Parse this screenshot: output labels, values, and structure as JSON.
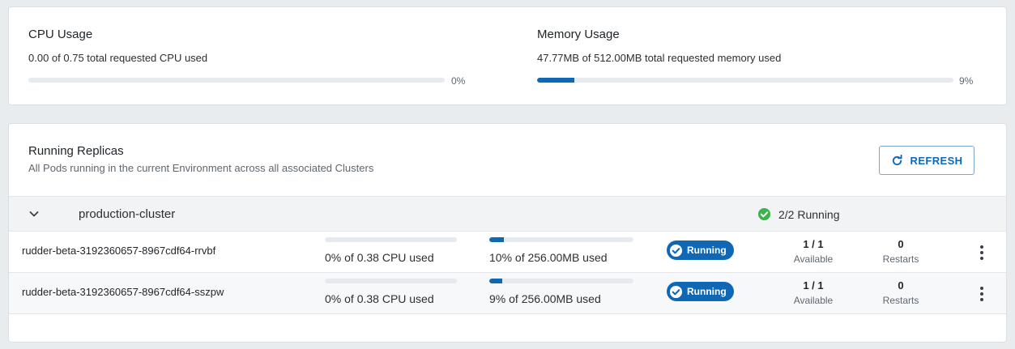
{
  "cpu": {
    "title": "CPU Usage",
    "subtitle": "0.00 of 0.75 total requested CPU used",
    "percent_label": "0%",
    "fill": 0
  },
  "memory": {
    "title": "Memory Usage",
    "subtitle": "47.77MB of 512.00MB total requested memory used",
    "percent_label": "9%",
    "fill": 9
  },
  "replicas": {
    "title": "Running Replicas",
    "subtitle": "All Pods running in the current Environment across all associated Clusters",
    "refresh_label": "REFRESH"
  },
  "cluster": {
    "name": "production-cluster",
    "status": "2/2 Running"
  },
  "pods": [
    {
      "name": "rudder-beta-3192360657-8967cdf64-rrvbf",
      "cpu_text": "0% of 0.38 CPU used",
      "cpu_fill": 0,
      "mem_text": "10% of 256.00MB used",
      "mem_fill": 10,
      "status": "Running",
      "available": "1 / 1",
      "available_label": "Available",
      "restarts": "0",
      "restarts_label": "Restarts"
    },
    {
      "name": "rudder-beta-3192360657-8967cdf64-sszpw",
      "cpu_text": "0% of 0.38 CPU used",
      "cpu_fill": 0,
      "mem_text": "9% of 256.00MB used",
      "mem_fill": 9,
      "status": "Running",
      "available": "1 / 1",
      "available_label": "Available",
      "restarts": "0",
      "restarts_label": "Restarts"
    }
  ],
  "colors": {
    "accent": "#1068b5",
    "success": "#3bb44a",
    "track": "#e6e9ee"
  },
  "icons": {
    "refresh": "refresh-icon",
    "expand": "chevron-down-icon",
    "cluster_ok": "check-circle-icon",
    "pod_running": "check-circle-icon",
    "menu": "more-vertical-icon"
  }
}
